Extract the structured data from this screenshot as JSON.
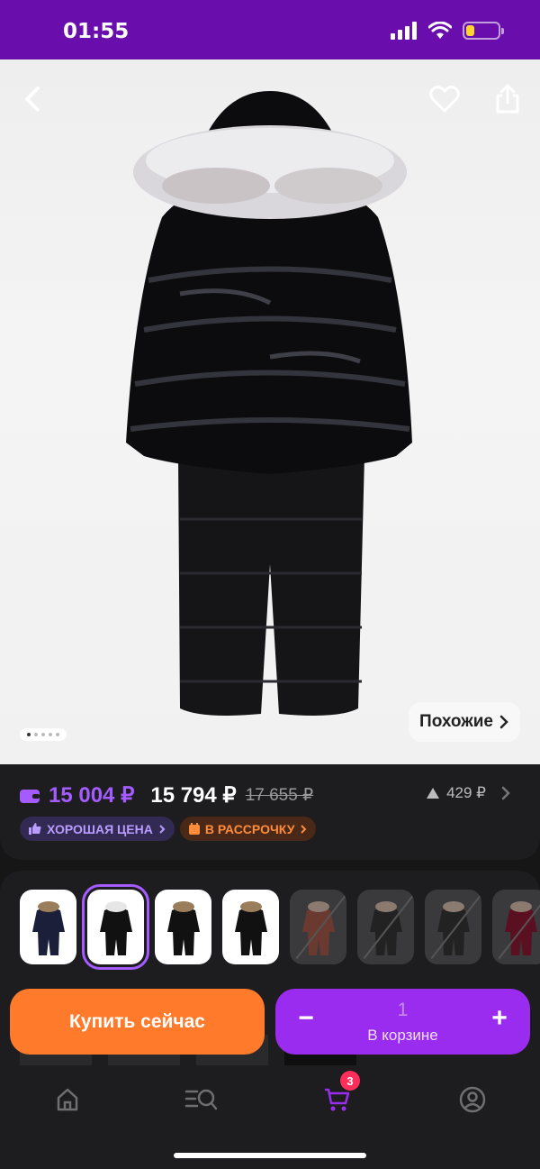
{
  "status_bar": {
    "time": "01:55",
    "battery_level": 0.25
  },
  "hero": {
    "similar_label": "Похожие",
    "dot_count": 5,
    "active_dot": 0
  },
  "price": {
    "wallet_price": "15 004 ₽",
    "main_price": "15 794 ₽",
    "old_price": "17 655 ₽",
    "price_change": "429 ₽",
    "badges": {
      "good_price": "ХОРОШАЯ ЦЕНА",
      "installments": "В РАССРОЧКУ"
    }
  },
  "variants": {
    "count": 8,
    "selected_index": 1,
    "unavailable_from": 4
  },
  "actions": {
    "buy_now": "Купить сейчас",
    "minus": "−",
    "plus": "+",
    "quantity": "1",
    "in_cart": "В корзине"
  },
  "tabbar": {
    "cart_count": "3"
  },
  "colors": {
    "status_bar": "#6a0dad",
    "accent_purple": "#9a2cf0",
    "accent_orange": "#ff7a2b",
    "wallet_price": "#a45bff",
    "badge_red": "#ff2e5b"
  }
}
